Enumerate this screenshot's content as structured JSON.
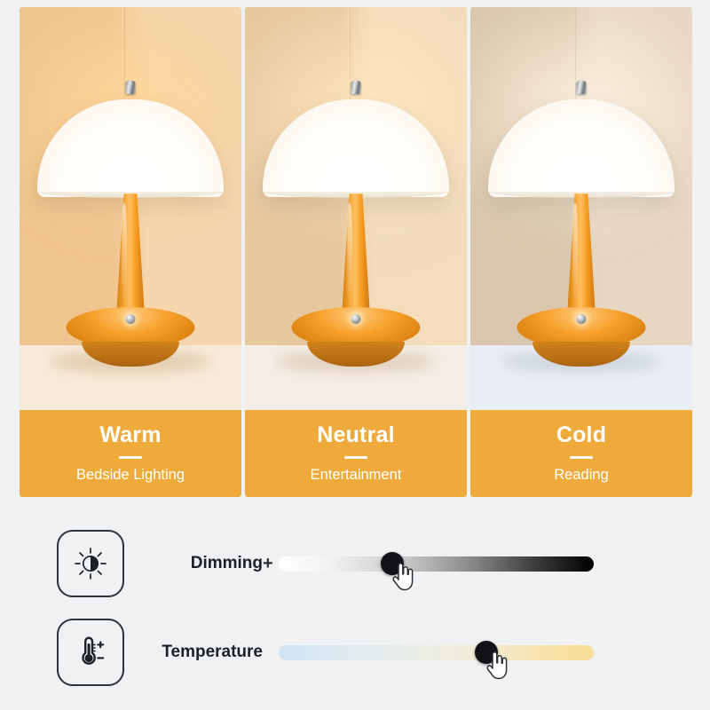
{
  "gallery": {
    "modes": [
      {
        "title": "Warm",
        "subtitle": "Bedside Lighting",
        "icon": "lamp-photo",
        "wall_color": "#f0c48e",
        "wall_color_right": "#f6d6ad",
        "table_color": "#f6ead9",
        "glow_color": "#ffd79a",
        "shadow_color": "#b98c52"
      },
      {
        "title": "Neutral",
        "subtitle": "Entertainment",
        "icon": "lamp-photo",
        "wall_color": "#e7c79c",
        "wall_color_right": "#f3ddbb",
        "table_color": "#f5eee6",
        "glow_color": "#ffe7c0",
        "shadow_color": "#b59268"
      },
      {
        "title": "Cold",
        "subtitle": "Reading",
        "icon": "lamp-photo",
        "wall_color": "#d9c6ac",
        "wall_color_right": "#e6d7c2",
        "table_color": "#e9eef5",
        "glow_color": "#fdf3e2",
        "shadow_color": "#9aa3b0"
      }
    ]
  },
  "controls": {
    "rows": [
      {
        "label": "Dimming",
        "icon": "brightness-icon",
        "plus_sign": "+",
        "knob_percent": 36,
        "track_start_color": "#ffffff",
        "track_end_color": "#000000",
        "cursor": "pointing-hand-cursor"
      },
      {
        "label": "Temperature",
        "icon": "thermometer-icon",
        "plus_sign": "",
        "knob_percent": 66,
        "track_start_color": "#cfe4f3",
        "track_end_color": "#f8dd95",
        "cursor": "pointing-hand-cursor"
      }
    ]
  },
  "theme": {
    "page_background": "#eff1f2",
    "caption_background": "#eeab3c",
    "caption_text": "#ffffff",
    "label_text": "#1d2024",
    "knob_color": "#111316"
  }
}
